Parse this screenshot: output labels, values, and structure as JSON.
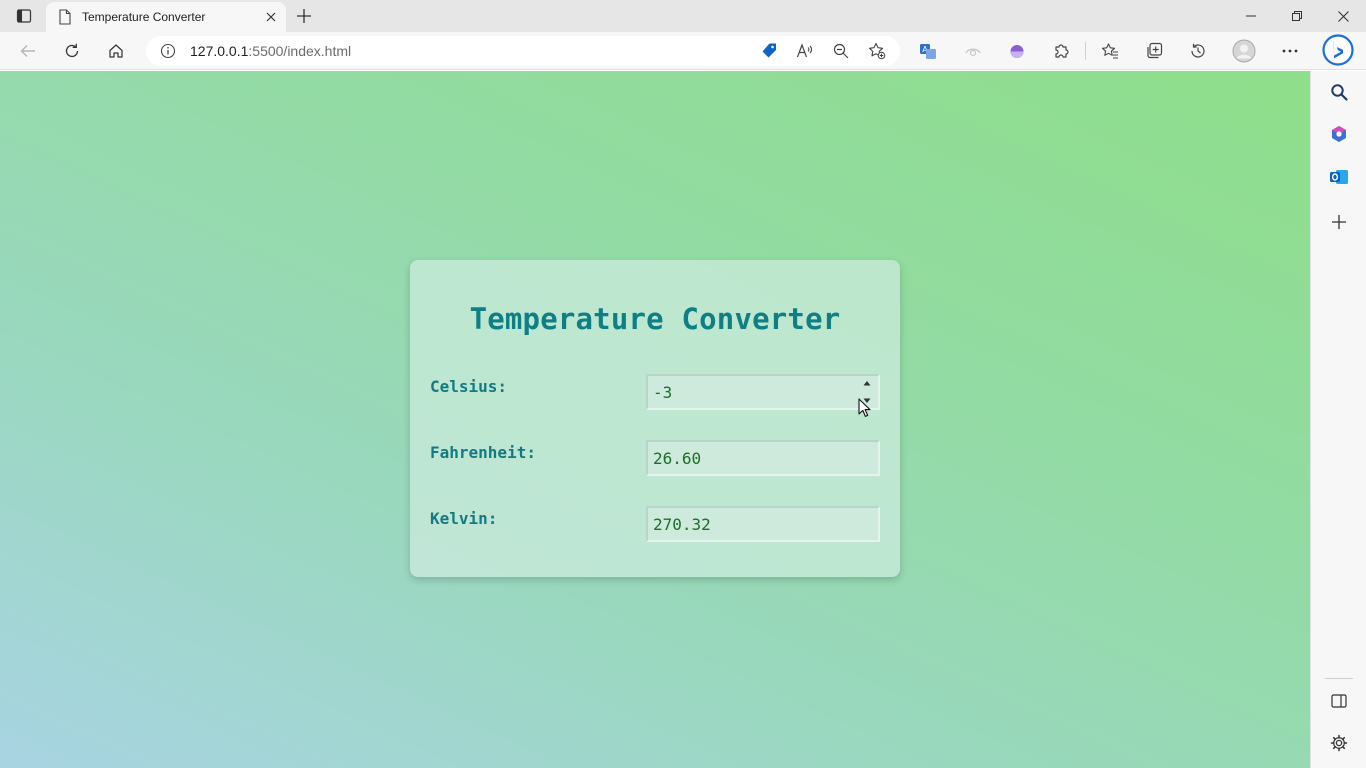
{
  "browser": {
    "tab": {
      "title": "Temperature Converter"
    },
    "address": {
      "host": "127.0.0.1",
      "path": ":5500/index.html"
    }
  },
  "page": {
    "title": "Temperature Converter",
    "fields": [
      {
        "label": "Celsius:",
        "value": "-3"
      },
      {
        "label": "Fahrenheit:",
        "value": "26.60"
      },
      {
        "label": "Kelvin:",
        "value": "270.32"
      }
    ]
  },
  "colors": {
    "title": "#0f7f86",
    "label": "#137a82",
    "input_text": "#1d6e2a",
    "bing": "#1a6fd6",
    "outlook": "#0a64c2",
    "shopping_tag": "#1063c9"
  },
  "icons": {
    "toolbar": [
      "back-icon",
      "refresh-icon",
      "home-icon",
      "info-icon",
      "shopping-tag-icon",
      "read-aloud-icon",
      "zoom-out-icon",
      "add-favorite-icon",
      "translate-icon",
      "tracking-icon",
      "extension-potion-icon",
      "extensions-icon",
      "favorites-icon",
      "collections-icon",
      "history-icon",
      "profile-icon",
      "more-icon",
      "bing-icon"
    ],
    "sidebar": [
      "search-icon",
      "office-icon",
      "outlook-icon",
      "add-icon",
      "sidebar-toggle-icon",
      "settings-icon"
    ]
  }
}
